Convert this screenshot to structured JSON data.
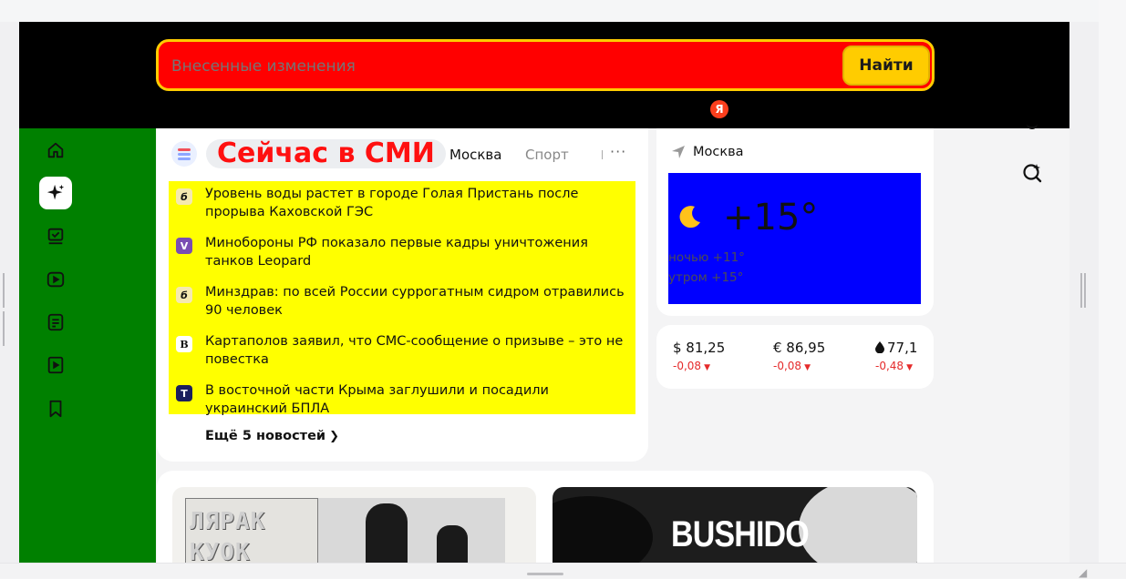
{
  "search": {
    "placeholder": "Внесенные изменения",
    "button_label": "Найти",
    "brand_badge": "Я"
  },
  "sidebar": {
    "items": [
      {
        "icon": "home-icon"
      },
      {
        "icon": "sparkle-icon",
        "active": true
      },
      {
        "icon": "tasks-icon"
      },
      {
        "icon": "video-icon"
      },
      {
        "icon": "article-icon"
      },
      {
        "icon": "play-icon"
      },
      {
        "icon": "bookmark-icon"
      }
    ]
  },
  "news": {
    "title": "Сейчас в СМИ",
    "tabs": [
      "Москва",
      "Спорт"
    ],
    "more_symbol": "···",
    "items": [
      {
        "source_glyph": "б",
        "source_color": "#f5e9b0",
        "text": "Уровень воды растет в городе Голая Пристань после прорыва Каховской ГЭС"
      },
      {
        "source_glyph": "V",
        "source_color": "#7a4db3",
        "text": "Минобороны РФ показало первые кадры уничтожения танков Leopard"
      },
      {
        "source_glyph": "б",
        "source_color": "#f5e9b0",
        "text": "Минздрав: по всей России суррогатным сидром отравились 90 человек"
      },
      {
        "source_glyph": "В",
        "source_color": "#ffffff",
        "text": "Картаполов заявил, что СМС-сообщение о призыве – это не повестка"
      },
      {
        "source_glyph": "Т",
        "source_color": "#1b1f5e",
        "text": "В восточной части Крыма заглушили и посадили украинский БПЛА"
      }
    ],
    "expand_label": "Ещё 5 новостей"
  },
  "weather": {
    "location": "Москва",
    "temperature": "+15°",
    "night": "ночью +11°",
    "morning": "утром +15°"
  },
  "rates": [
    {
      "value": "$ 81,25",
      "change": "-0,08"
    },
    {
      "value": "€ 86,95",
      "change": "-0,08"
    },
    {
      "value": "77,1",
      "change": "-0,48",
      "icon": "oil-drop-icon"
    }
  ],
  "promo": {
    "card1_text_line1": "ЛЯРАК",
    "card1_text_line2": "КУОК",
    "card2_text": "BUSHIDO"
  },
  "colors": {
    "header_bg": "#000000",
    "search_bg": "#ff0000",
    "search_border": "#ffcc00",
    "sidebar_bg": "#008000",
    "news_list_bg": "#ffff00",
    "weather_box_bg": "#0000ff",
    "news_title_color": "#ff1010",
    "negative": "#e52b2b"
  }
}
